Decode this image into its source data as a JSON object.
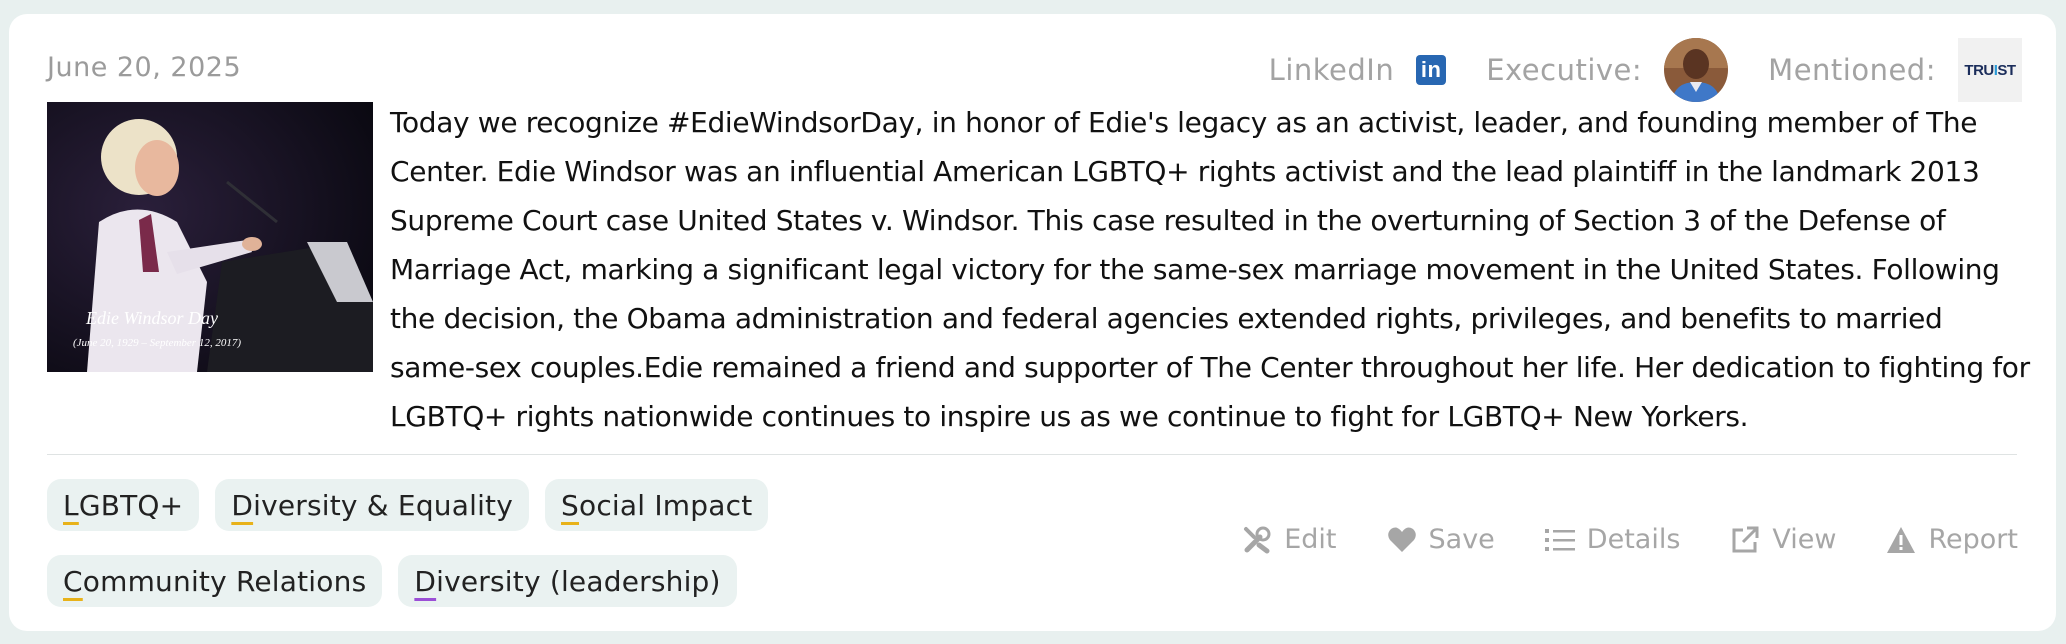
{
  "post": {
    "date": "June 20, 2025",
    "text": "Today we recognize #EdieWindsorDay, in honor of Edie's legacy as an activist, leader, and founding member of The Center. Edie Windsor was an influential American LGBTQ+ rights activist and the lead plaintiff in the landmark 2013 Supreme Court case United States v. Windsor. This case resulted in the overturning of Section 3 of the Defense of Marriage Act, marking a significant legal victory for the same-sex marriage movement in the United States. Following the decision, the Obama administration and federal agencies extended rights, privileges, and benefits to married same-sex couples.Edie remained a friend and supporter of The Center throughout her life. Her dedication to fighting for LGBTQ+ rights nationwide continues to inspire us as we continue to fight for LGBTQ+ New Yorkers.",
    "image": {
      "caption_title": "Edie Windsor Day",
      "caption_dates": "(June 20, 1929 – September 12, 2017)"
    }
  },
  "meta": {
    "linkedin_label": "LinkedIn",
    "linkedin_icon": "linkedin-icon",
    "executive_label": "Executive:",
    "mentioned_label": "Mentioned:",
    "mentioned_logo_text": "TRU",
    "mentioned_logo_slash": "I",
    "mentioned_logo_text2": "ST"
  },
  "tags": [
    {
      "first": "L",
      "rest": "GBTQ+",
      "underline_color": "#e8b21a"
    },
    {
      "first": "D",
      "rest": "iversity & Equality",
      "underline_color": "#e8b21a"
    },
    {
      "first": "S",
      "rest": "ocial Impact",
      "underline_color": "#e8b21a"
    },
    {
      "first": "C",
      "rest": "ommunity Relations",
      "underline_color": "#e8b21a"
    },
    {
      "first": "D",
      "rest": "iversity (leadership)",
      "underline_color": "#9b4fd6"
    }
  ],
  "actions": {
    "edit": "Edit",
    "save": "Save",
    "details": "Details",
    "view": "View",
    "report": "Report"
  },
  "colors": {
    "linkedin": "#2867b2",
    "accent_yellow": "#e8b21a",
    "accent_purple": "#9b4fd6",
    "tag_bg": "#eaf2f1"
  }
}
